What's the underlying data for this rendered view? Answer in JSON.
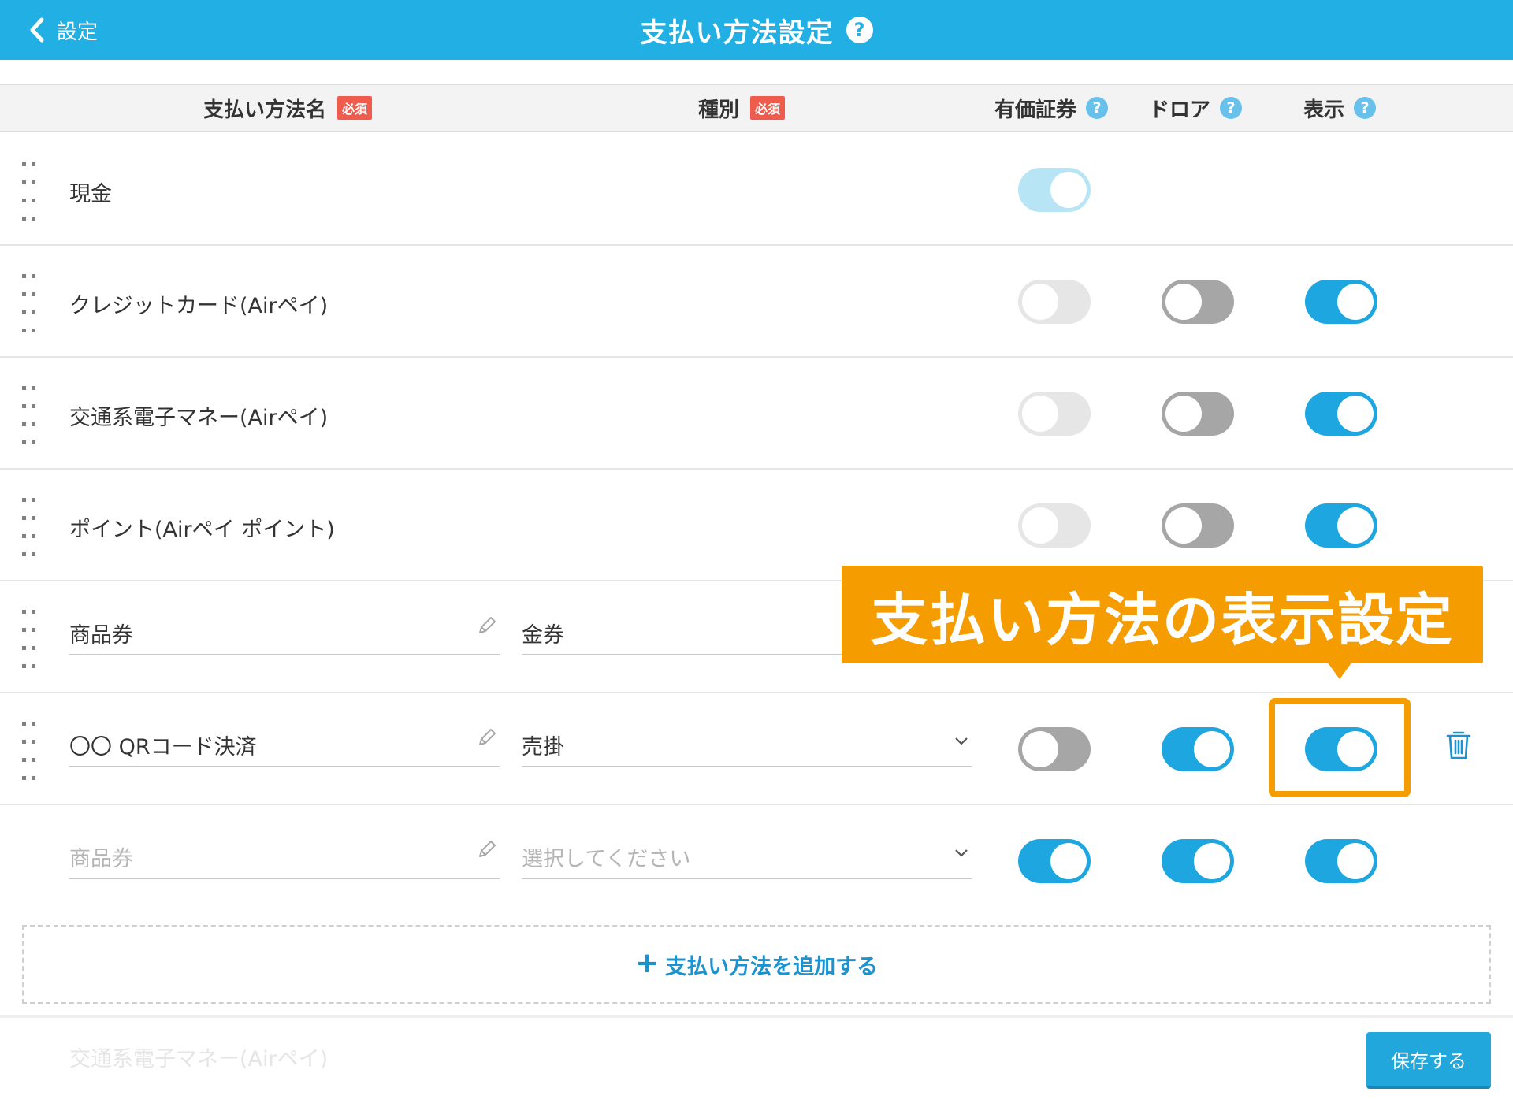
{
  "header": {
    "back_label": "設定",
    "title": "支払い方法設定",
    "help_glyph": "?"
  },
  "columns": {
    "name": "支払い方法名",
    "type": "種別",
    "required_badge": "必須",
    "securities": "有価証券",
    "drawer": "ドロア",
    "display": "表示",
    "help_glyph": "?"
  },
  "rows": [
    {
      "name": "現金",
      "securities": "on-disabled"
    },
    {
      "name": "クレジットカード(Airペイ)",
      "securities": "off",
      "drawer": "off",
      "display": "on"
    },
    {
      "name": "交通系電子マネー(Airペイ)",
      "securities": "off",
      "drawer": "off",
      "display": "on"
    },
    {
      "name": "ポイント(Airペイ ポイント)",
      "securities": "off",
      "drawer": "off",
      "display": "on"
    },
    {
      "name": "商品券",
      "type": "金券"
    },
    {
      "name": "〇〇 QRコード決済",
      "type": "売掛",
      "securities": "off",
      "drawer": "on",
      "display": "on"
    },
    {
      "name_placeholder": "商品券",
      "type_placeholder": "選択してください",
      "securities": "on",
      "drawer": "on",
      "display": "on"
    }
  ],
  "annotation": {
    "label": "支払い方法の表示設定"
  },
  "add_button": {
    "plus": "+",
    "label": "支払い方法を追加する"
  },
  "ghost_row": {
    "name": "交通系電子マネー(Airペイ)"
  },
  "save_button": {
    "label": "保存する"
  },
  "colors": {
    "header": "#22b0e4",
    "toggle_on": "#1da6e0",
    "accent_orange": "#f59c00",
    "required_red": "#ef5b4c"
  }
}
